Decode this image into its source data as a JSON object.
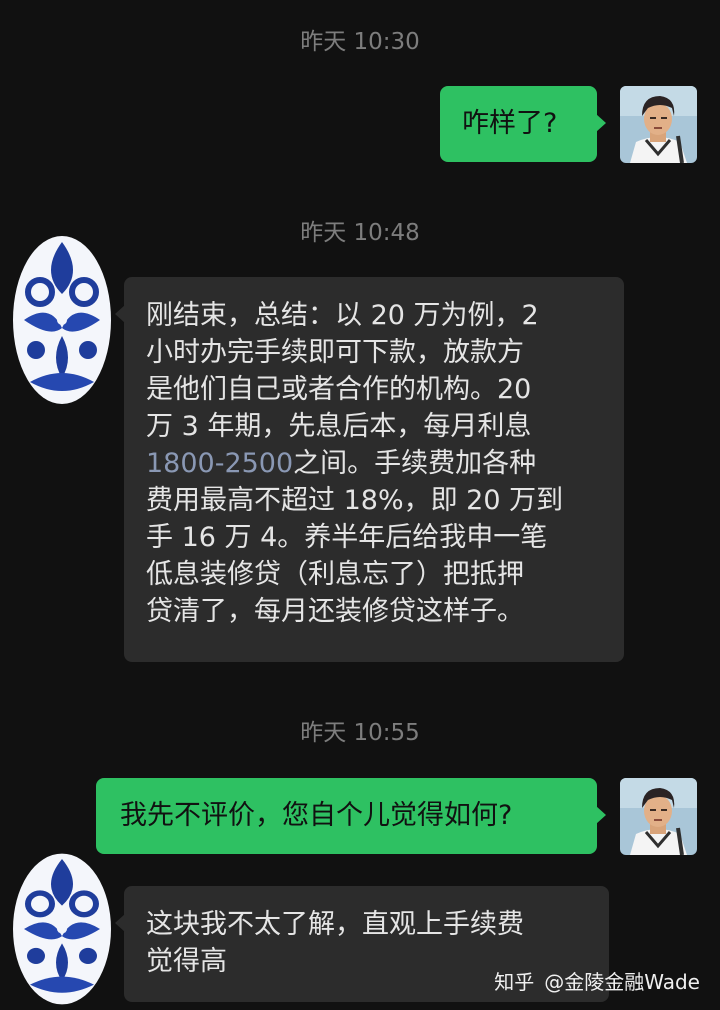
{
  "chat": {
    "messages": [
      {
        "time": "昨天 10:30",
        "sender": "me",
        "text": "咋样了?"
      },
      {
        "time": "昨天 10:48",
        "sender": "other",
        "lines": [
          "刚结束，总结：以 20 万为例，2",
          "小时办完手续即可下款，放款方",
          "是他们自己或者合作的机构。20",
          "万 3 年期，先息后本，每月利息",
          "之间。手续费加各种",
          "费用最高不超过 18%，即 20 万到",
          "手 16 万 4。养半年后给我申一笔",
          "低息装修贷（利息忘了）把抵押",
          "贷清了，每月还装修贷这样子。"
        ],
        "link_text": "1800-2500"
      },
      {
        "time": "昨天 10:55",
        "sender": "me",
        "text": "我先不评价，您自个儿觉得如何?"
      },
      {
        "sender": "other",
        "lines": [
          "这块我不太了解，直观上手续费",
          "觉得高"
        ]
      }
    ]
  },
  "watermark": {
    "site": "知乎",
    "author": "@金陵金融Wade"
  },
  "colors": {
    "background": "#111111",
    "outgoing_bubble": "#2ec162",
    "incoming_bubble": "#2c2c2c",
    "timestamp": "#7d7d7d",
    "link": "#8a98b4"
  },
  "icons": {
    "my_avatar": "anime-man-avatar",
    "other_avatar": "blue-white-porcelain-avatar"
  }
}
